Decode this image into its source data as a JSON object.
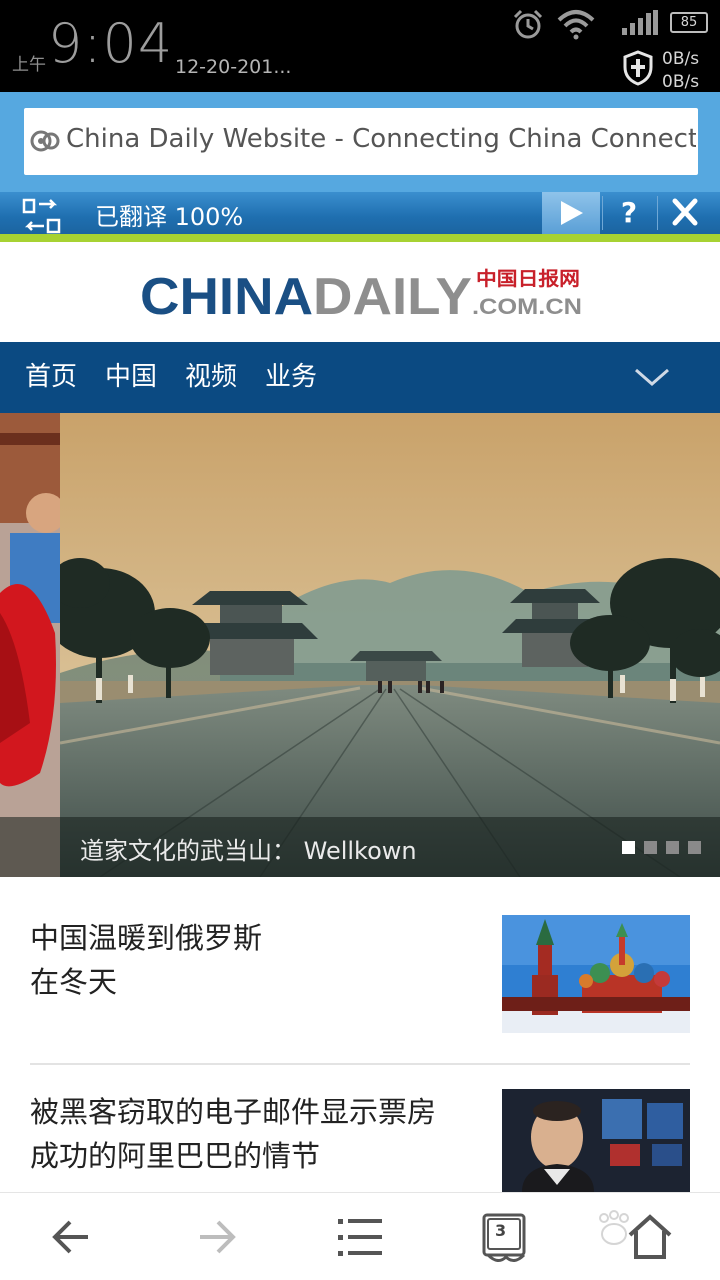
{
  "status_bar": {
    "ampm": "上午",
    "time": "9:04",
    "date": "12-20-201...",
    "battery": "85",
    "net_up": "0B/s",
    "net_down": "0B/s"
  },
  "address_bar": {
    "title": "China Daily Website - Connecting China Connecti"
  },
  "translate_bar": {
    "status": "已翻译 100%",
    "help": "?"
  },
  "logo": {
    "main": "CHINADAILY",
    "cn": "中国日报网",
    "domain": ".COM.CN"
  },
  "nav": {
    "items": [
      "首页",
      "中国",
      "视频",
      "业务"
    ]
  },
  "hero": {
    "caption": "道家文化的武当山： Wellkown",
    "slide_count": 4,
    "active_slide": 1
  },
  "news": [
    {
      "title": "中国温暖到俄罗斯在冬天",
      "line1": "中国温暖到俄罗斯",
      "line2": "在冬天"
    },
    {
      "title": "被黑客窃取的电子邮件显示票房成功的阿里巴巴的情节",
      "line1": "被黑客窃取的电子邮件显示票房",
      "line2": "成功的阿里巴巴的情节"
    }
  ],
  "bottom_bar": {
    "tab_count": "3"
  },
  "colors": {
    "address_bg": "#56a8e0",
    "nav_bg": "#0b4a82",
    "translate_accent": "#a7d232",
    "logo_blue": "#1a4f84"
  }
}
